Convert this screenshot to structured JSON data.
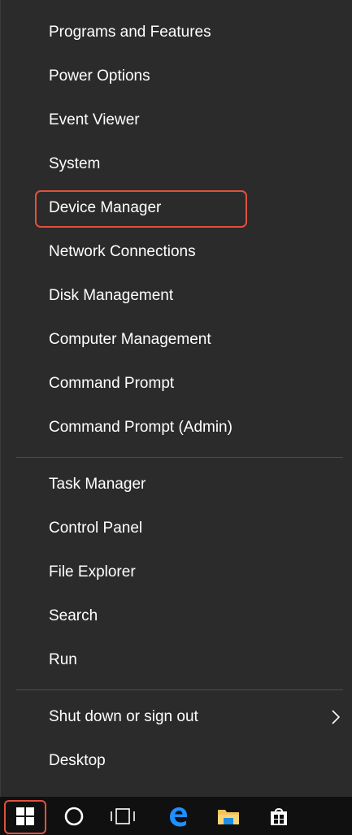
{
  "menu": {
    "group1": [
      {
        "label": "Programs and Features"
      },
      {
        "label": "Power Options"
      },
      {
        "label": "Event Viewer"
      },
      {
        "label": "System"
      },
      {
        "label": "Device Manager"
      },
      {
        "label": "Network Connections"
      },
      {
        "label": "Disk Management"
      },
      {
        "label": "Computer Management"
      },
      {
        "label": "Command Prompt"
      },
      {
        "label": "Command Prompt (Admin)"
      }
    ],
    "group2": [
      {
        "label": "Task Manager"
      },
      {
        "label": "Control Panel"
      },
      {
        "label": "File Explorer"
      },
      {
        "label": "Search"
      },
      {
        "label": "Run"
      }
    ],
    "group3": [
      {
        "label": "Shut down or sign out"
      },
      {
        "label": "Desktop"
      }
    ]
  },
  "highlighted_item": "Device Manager",
  "taskbar": {
    "icons": [
      "windows-start-icon",
      "cortana-circle-icon",
      "task-view-icon",
      "edge-browser-icon",
      "file-explorer-icon",
      "store-icon"
    ]
  },
  "colors": {
    "menu_background": "#2b2b2b",
    "taskbar_background": "#101010",
    "highlight_border": "#e0513e",
    "accent_blue": "#0078d7",
    "text": "#ffffff"
  }
}
